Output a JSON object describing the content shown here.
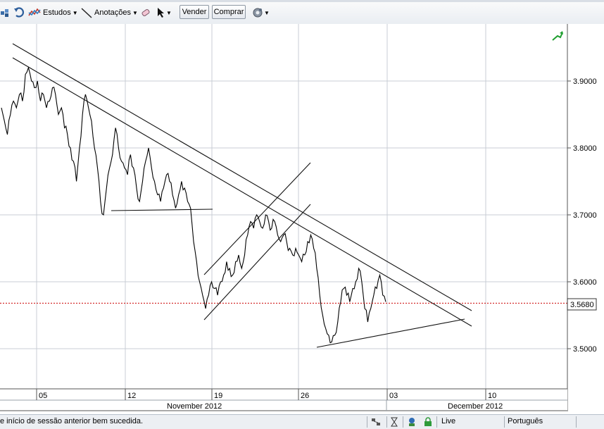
{
  "toolbar": {
    "studies_label": "Estudos",
    "annotations_label": "Anotações",
    "sell_label": "Vender",
    "buy_label": "Comprar"
  },
  "chart_data": {
    "type": "line",
    "title": "",
    "xlabel": "",
    "ylabel": "",
    "ylim": [
      3.43,
      3.98
    ],
    "y_ticks": [
      "3.9000",
      "3.8000",
      "3.7000",
      "3.6000",
      "3.5000"
    ],
    "current_price": "3.5680",
    "x_ticks": [
      "05",
      "12",
      "19",
      "26",
      "03",
      "10"
    ],
    "months": [
      "November 2012",
      "December 2012"
    ],
    "series": [
      {
        "values": [
          3.86,
          3.84,
          3.82,
          3.85,
          3.87,
          3.86,
          3.88,
          3.87,
          3.91,
          3.92,
          3.9,
          3.89,
          3.9,
          3.87,
          3.88,
          3.86,
          3.87,
          3.89,
          3.88,
          3.85,
          3.86,
          3.83,
          3.82,
          3.8,
          3.78,
          3.75,
          3.8,
          3.85,
          3.88,
          3.86,
          3.84,
          3.8,
          3.77,
          3.72,
          3.7,
          3.74,
          3.77,
          3.79,
          3.83,
          3.8,
          3.78,
          3.77,
          3.76,
          3.79,
          3.77,
          3.74,
          3.72,
          3.75,
          3.78,
          3.8,
          3.77,
          3.75,
          3.73,
          3.72,
          3.74,
          3.76,
          3.75,
          3.73,
          3.71,
          3.73,
          3.75,
          3.74,
          3.72,
          3.71,
          3.66,
          3.63,
          3.6,
          3.58,
          3.56,
          3.58,
          3.6,
          3.59,
          3.58,
          3.6,
          3.61,
          3.63,
          3.62,
          3.61,
          3.63,
          3.64,
          3.62,
          3.64,
          3.67,
          3.69,
          3.68,
          3.7,
          3.69,
          3.68,
          3.7,
          3.69,
          3.68,
          3.69,
          3.67,
          3.66,
          3.67,
          3.66,
          3.65,
          3.64,
          3.65,
          3.64,
          3.63,
          3.64,
          3.66,
          3.67,
          3.65,
          3.62,
          3.58,
          3.55,
          3.53,
          3.52,
          3.51,
          3.52,
          3.54,
          3.57,
          3.59,
          3.58,
          3.57,
          3.59,
          3.6,
          3.62,
          3.6,
          3.56,
          3.54,
          3.56,
          3.58,
          3.59,
          3.61,
          3.58,
          3.57
        ]
      }
    ],
    "trendlines": "drawn",
    "grid": true
  },
  "status": {
    "message": "e início de sessão anterior bem sucedida.",
    "connection": "Live",
    "language": "Português"
  },
  "colors": {
    "current_price_line": "#cc0000",
    "grid": "#c8cdd4",
    "price": "#000000"
  }
}
